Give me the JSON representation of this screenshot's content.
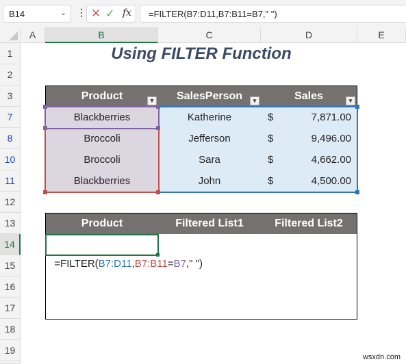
{
  "formula_bar": {
    "name_box": "B14",
    "formula": "=FILTER(B7:D11,B7:B11=B7,\" \")",
    "cancel_icon": "x-icon",
    "enter_icon": "check-icon",
    "fx_label": "fx"
  },
  "columns": [
    "A",
    "B",
    "C",
    "D",
    "E"
  ],
  "rows": [
    "1",
    "2",
    "3",
    "7",
    "8",
    "10",
    "11",
    "12",
    "13",
    "14",
    "15",
    "16",
    "17",
    "18",
    "19"
  ],
  "title": "Using FILTER Function",
  "source_table": {
    "headers": [
      "Product",
      "SalesPerson",
      "Sales"
    ],
    "rows": [
      {
        "product": "Blackberries",
        "salesperson": "Katherine",
        "currency": "$",
        "sales": "7,871.00"
      },
      {
        "product": "Broccoli",
        "salesperson": "Jefferson",
        "currency": "$",
        "sales": "9,496.00"
      },
      {
        "product": "Broccoli",
        "salesperson": "Sara",
        "currency": "$",
        "sales": "4,662.00"
      },
      {
        "product": "Blackberries",
        "salesperson": "John",
        "currency": "$",
        "sales": "4,500.00"
      }
    ]
  },
  "output_table": {
    "headers": [
      "Product",
      "Filtered List1",
      "Filtered List2"
    ],
    "formula_parts": [
      {
        "text": "=FILTER(",
        "color": "#222222"
      },
      {
        "text": "B7:D11",
        "color": "#2e75b6"
      },
      {
        "text": ",",
        "color": "#222222"
      },
      {
        "text": "B7:B11",
        "color": "#c0504d"
      },
      {
        "text": "=",
        "color": "#222222"
      },
      {
        "text": "B7",
        "color": "#8064a2"
      },
      {
        "text": ",\" \")",
        "color": "#222222"
      }
    ]
  },
  "watermark": "wsxdn.com"
}
